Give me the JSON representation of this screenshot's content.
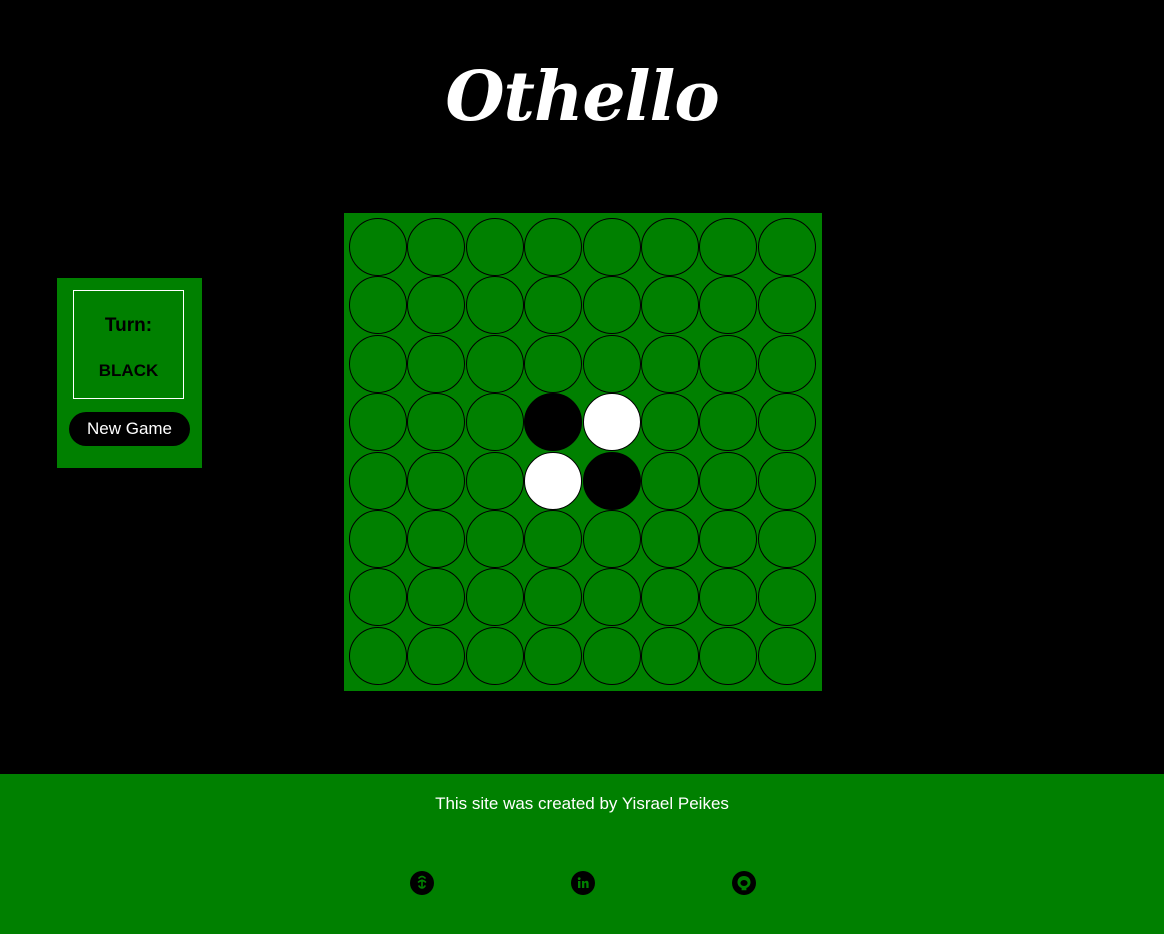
{
  "header": {
    "title": "Othello"
  },
  "status": {
    "turn_label": "Turn:",
    "turn_value": "BLACK"
  },
  "controls": {
    "new_game_label": "New Game"
  },
  "board": {
    "size": 8,
    "colors": {
      "board": "#008000",
      "black": "#000000",
      "white": "#ffffff"
    },
    "pieces": [
      {
        "row": 3,
        "col": 3,
        "color": "black"
      },
      {
        "row": 3,
        "col": 4,
        "color": "white"
      },
      {
        "row": 4,
        "col": 3,
        "color": "white"
      },
      {
        "row": 4,
        "col": 4,
        "color": "black"
      }
    ]
  },
  "footer": {
    "credit": "This site was created by Yisrael Peikes",
    "links": [
      {
        "icon": "codewars-icon"
      },
      {
        "icon": "linkedin-icon"
      },
      {
        "icon": "github-icon"
      }
    ]
  },
  "theme": {
    "background": "#000000",
    "accent": "#008000",
    "text": "#ffffff"
  }
}
